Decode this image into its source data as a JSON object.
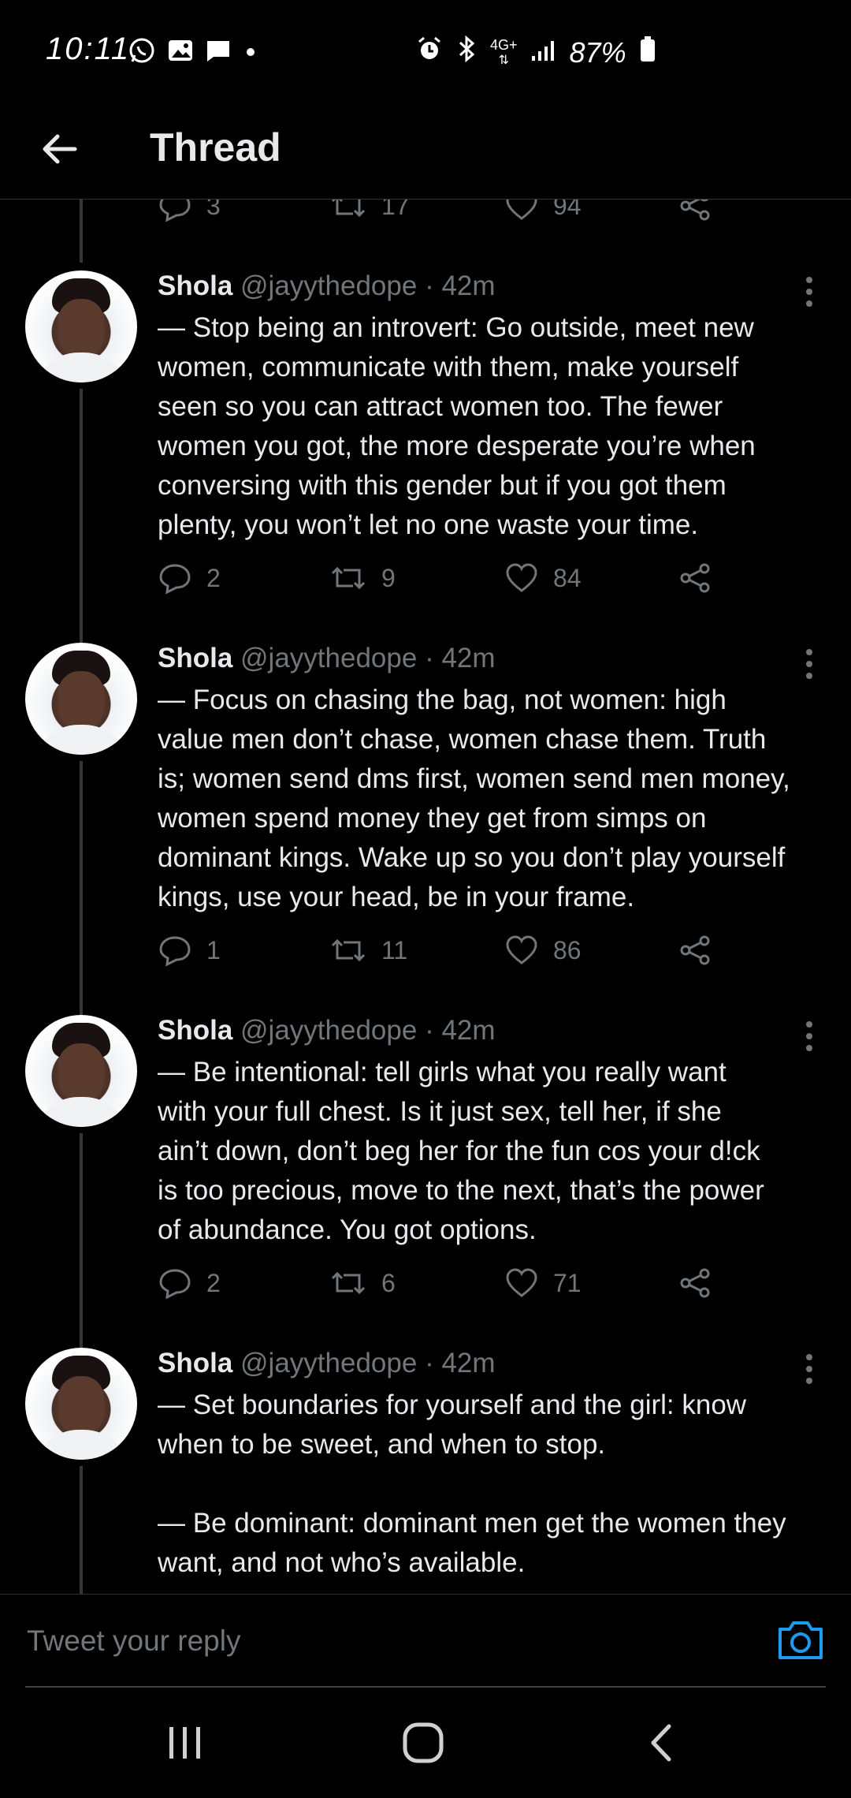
{
  "status_bar": {
    "time": "10:11",
    "battery": "87%",
    "network": "4G+",
    "left_icons": [
      "whatsapp-icon",
      "gallery-icon",
      "message-icon",
      "dot-icon"
    ],
    "right_icons": [
      "alarm-icon",
      "bluetooth-icon",
      "network-4g-icon",
      "signal-icon",
      "battery-icon"
    ]
  },
  "header": {
    "title": "Thread"
  },
  "previous_tweet_actions": {
    "replies": "3",
    "retweets": "17",
    "likes": "94"
  },
  "tweets": [
    {
      "name": "Shola",
      "handle": "@jayythedope",
      "time": "· 42m",
      "text": "— Stop being an introvert: Go outside, meet new\nwomen, communicate with them, make yourself\nseen so you can attract women too. The fewer\nwomen you got, the more desperate you’re  when\nconversing with this gender but if you got them\nplenty, you won’t let no one waste your time.",
      "replies": "2",
      "retweets": "9",
      "likes": "84"
    },
    {
      "name": "Shola",
      "handle": "@jayythedope",
      "time": "· 42m",
      "text": "— Focus on chasing the bag, not women: high\nvalue men don’t chase, women chase them. Truth\nis; women send dms first, women send men money,\nwomen spend money they get from simps on\ndominant kings. Wake up so you don’t play yourself\nkings, use your head, be in your frame.",
      "replies": "1",
      "retweets": "11",
      "likes": "86"
    },
    {
      "name": "Shola",
      "handle": "@jayythedope",
      "time": "· 42m",
      "text": "— Be intentional: tell girls what you really want\nwith your full chest. Is it just sex, tell her, if she\nain’t down, don’t beg her for the fun cos your d!ck\nis too precious, move to the next, that’s the power\nof abundance. You got options.",
      "replies": "2",
      "retweets": "6",
      "likes": "71"
    },
    {
      "name": "Shola",
      "handle": "@jayythedope",
      "time": "· 42m",
      "text": "— Set boundaries for yourself and the girl: know\nwhen to be sweet, and when to stop.\n\n— Be dominant: dominant men get the women they\nwant, and not who’s available."
    }
  ],
  "reply_bar": {
    "placeholder": "Tweet your reply"
  },
  "nav_bar": {
    "buttons": [
      "recents-icon",
      "home-icon",
      "back-icon"
    ]
  },
  "colors": {
    "background": "#000000",
    "text": "#e7e9ea",
    "muted": "#71767b",
    "accent": "#1d9bf0",
    "divider": "#2f3336"
  }
}
